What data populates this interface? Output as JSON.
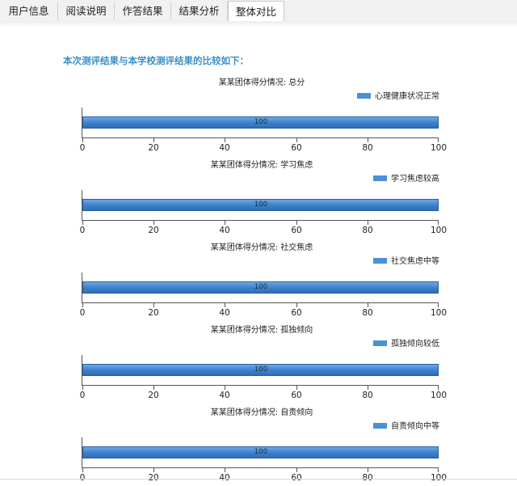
{
  "tabs": [
    {
      "label": "用户信息",
      "active": false
    },
    {
      "label": "阅读说明",
      "active": false
    },
    {
      "label": "作答结果",
      "active": false
    },
    {
      "label": "结果分析",
      "active": false
    },
    {
      "label": "整体对比",
      "active": true
    }
  ],
  "intro_text": "本次测评结果与本学校测评结果的比较如下：",
  "colors": {
    "bar": "#4a90d9",
    "intro": "#3b8fc4"
  },
  "chart_data": [
    {
      "type": "bar",
      "orientation": "horizontal",
      "title": "某某团体得分情况: 总分",
      "legend": "心理健康状况正常",
      "legend_position": "top-right",
      "values": [
        100
      ],
      "data_labels": [
        "100"
      ],
      "xlim": [
        0,
        100
      ],
      "ticks": [
        "0",
        "20",
        "40",
        "60",
        "80",
        "100"
      ]
    },
    {
      "type": "bar",
      "orientation": "horizontal",
      "title": "某某团体得分情况: 学习焦虑",
      "legend": "学习焦虑较高",
      "legend_position": "top-right",
      "values": [
        100
      ],
      "data_labels": [
        "100"
      ],
      "xlim": [
        0,
        100
      ],
      "ticks": [
        "0",
        "20",
        "40",
        "60",
        "80",
        "100"
      ]
    },
    {
      "type": "bar",
      "orientation": "horizontal",
      "title": "某某团体得分情况: 社交焦虑",
      "legend": "社交焦虑中等",
      "legend_position": "top-right",
      "values": [
        100
      ],
      "data_labels": [
        "100"
      ],
      "xlim": [
        0,
        100
      ],
      "ticks": [
        "0",
        "20",
        "40",
        "60",
        "80",
        "100"
      ]
    },
    {
      "type": "bar",
      "orientation": "horizontal",
      "title": "某某团体得分情况: 孤独倾向",
      "legend": "孤独倾向较低",
      "legend_position": "top-right",
      "values": [
        100
      ],
      "data_labels": [
        "100"
      ],
      "xlim": [
        0,
        100
      ],
      "ticks": [
        "0",
        "20",
        "40",
        "60",
        "80",
        "100"
      ]
    },
    {
      "type": "bar",
      "orientation": "horizontal",
      "title": "某某团体得分情况: 自责倾向",
      "legend": "自责倾向中等",
      "legend_position": "top-right",
      "values": [
        100
      ],
      "data_labels": [
        "100"
      ],
      "xlim": [
        0,
        100
      ],
      "ticks": [
        "0",
        "20",
        "40",
        "60",
        "80",
        "100"
      ]
    }
  ]
}
